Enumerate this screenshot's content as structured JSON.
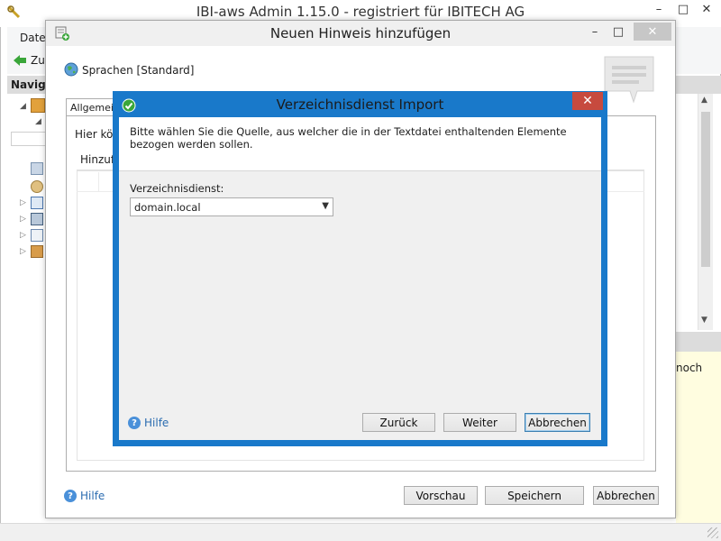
{
  "main_window": {
    "title": "IBI-aws Admin 1.15.0 - registriert für IBITECH AG",
    "menu_first": "Datei",
    "toolbar_back": "Zurück",
    "nav_header": "Navigation",
    "right_note": "noch"
  },
  "hint_dialog": {
    "title": "Neuen Hinweis hinzufügen",
    "language": "Sprachen [Standard]",
    "tab_general": "Allgemein",
    "description": "Hier können",
    "grid_header": "Hinzufügen",
    "help": "Hilfe",
    "buttons": {
      "preview": "Vorschau",
      "save": "Speichern",
      "cancel": "Abbrechen"
    }
  },
  "import_dialog": {
    "title": "Verzeichnisdienst Import",
    "info": "Bitte wählen Sie die Quelle, aus welcher die in der Textdatei enthaltenden Elemente bezogen werden sollen.",
    "directory_label": "Verzeichnisdienst:",
    "directory_value": "domain.local",
    "help": "Hilfe",
    "buttons": {
      "back": "Zurück",
      "next": "Weiter",
      "cancel": "Abbrechen"
    }
  },
  "colors": {
    "accent": "#1979ca",
    "close": "#c74a3e",
    "help_link": "#2b6cb0"
  }
}
